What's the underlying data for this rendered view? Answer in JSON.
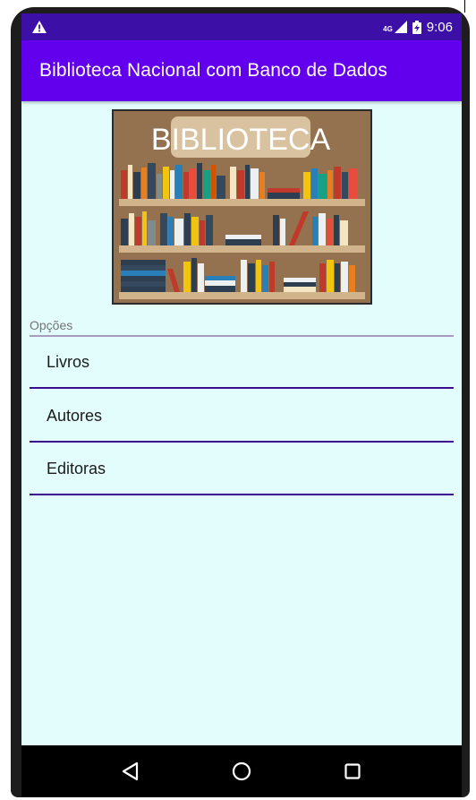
{
  "status_bar": {
    "network": "4G",
    "time": "9:06",
    "icons": [
      "warning-icon",
      "signal-icon",
      "battery-icon"
    ]
  },
  "app_bar": {
    "title": "Biblioteca Nacional com Banco de Dados"
  },
  "hero_image": {
    "banner_text": "BIBLIOTECA"
  },
  "options_section": {
    "label": "Opções",
    "items": [
      {
        "label": "Livros"
      },
      {
        "label": "Autores"
      },
      {
        "label": "Editoras"
      }
    ]
  },
  "nav_bar": {
    "buttons": [
      "back-icon",
      "home-icon",
      "recents-icon"
    ]
  },
  "colors": {
    "status_bar": "#3c10a6",
    "app_bar": "#6200ee",
    "background": "#e3fdfd",
    "divider": "#3a0d8f"
  }
}
